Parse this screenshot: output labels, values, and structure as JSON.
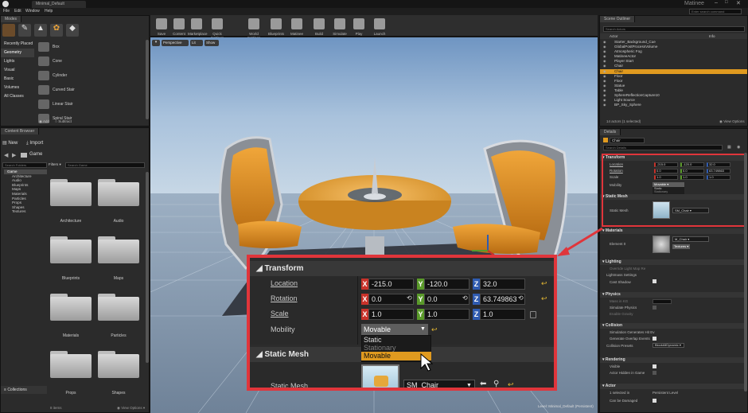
{
  "app": {
    "project_tab": "Minimal_Default",
    "window_title": "Matinee",
    "search_help_placeholder": "Enter search command"
  },
  "menu": [
    "File",
    "Edit",
    "Window",
    "Help"
  ],
  "modes": {
    "tab": "Modes",
    "categories": [
      "Recently Placed",
      "Geometry",
      "Lights",
      "Visual",
      "Basic",
      "Volumes",
      "All Classes"
    ],
    "selected_category": "Geometry",
    "items": [
      "Box",
      "Cone",
      "Cylinder",
      "Curved Stair",
      "Linear Stair",
      "Spiral Stair"
    ],
    "add_label": "Add",
    "subtract_label": "Subtract"
  },
  "toolbar": [
    {
      "label": "Save",
      "icon": "save-icon"
    },
    {
      "label": "Content",
      "icon": "content-icon"
    },
    {
      "label": "Marketplace",
      "icon": "marketplace-icon"
    },
    {
      "label": "Quick Settings",
      "icon": "settings-icon"
    },
    {
      "label": "World Settings",
      "icon": "world-icon"
    },
    {
      "label": "Blueprints",
      "icon": "blueprint-icon"
    },
    {
      "label": "Matinee",
      "icon": "matinee-icon"
    },
    {
      "label": "Build",
      "icon": "build-icon"
    },
    {
      "label": "Simulate",
      "icon": "simulate-icon"
    },
    {
      "label": "Play",
      "icon": "play-icon"
    },
    {
      "label": "Launch",
      "icon": "launch-icon"
    }
  ],
  "viewport": {
    "perspective": "Perspective",
    "lit": "Lit",
    "show": "Show",
    "level_label": "Level:",
    "level_name": "Minimal_Default (Persistent)"
  },
  "content_browser": {
    "tab": "Content Browser",
    "new_label": "New",
    "import_label": "Import",
    "path": "Game",
    "search_folders_placeholder": "Search Folders",
    "filters_label": "Filters",
    "search_game_placeholder": "Search Game",
    "tree": [
      "Game",
      "Architecture",
      "Audio",
      "Blueprints",
      "Maps",
      "Materials",
      "Particles",
      "Props",
      "Shapes",
      "Textures"
    ],
    "folders": [
      "Architecture",
      "Audio",
      "Blueprints",
      "Maps",
      "Materials",
      "Particles",
      "Props",
      "Shapes"
    ],
    "collections_label": "Collections",
    "item_count": "8 items",
    "view_options": "View Options"
  },
  "outliner": {
    "tab": "Scene Outliner",
    "search_placeholder": "Search Actors",
    "col_actor": "Actor",
    "col_info": "Info",
    "rows": [
      "Starter_Background_Cue",
      "GlobalPostProcessVolume",
      "Atmospheric Fog",
      "MatineeActor",
      "Player Start",
      "Chair",
      "Chair",
      "Floor",
      "Floor",
      "Statue",
      "Table",
      "SphereReflectionCapture10",
      "Light Source",
      "BP_Sky_Sphere"
    ],
    "selected_index": 6,
    "status": "14 actors (1 selected)",
    "view_options": "View Options"
  },
  "details": {
    "tab": "Details",
    "name": "Chair",
    "search_placeholder": "Search Details",
    "transform": {
      "section": "Transform",
      "location_label": "Location",
      "rotation_label": "Rotation",
      "scale_label": "Scale",
      "mobility_label": "Mobility",
      "location": [
        "-215.0",
        "-120.0",
        "32.0"
      ],
      "rotation": [
        "0.0",
        "0.0",
        "63.749863"
      ],
      "scale": [
        "1.0",
        "1.0",
        "1.0"
      ],
      "mobility_value": "Movable",
      "mobility_options": [
        "Static",
        "Stationary",
        "Movable"
      ]
    },
    "static_mesh": {
      "section": "Static Mesh",
      "label": "Static Mesh",
      "value": "SM_Chair"
    },
    "materials": {
      "section": "Materials",
      "element_label": "Element 0",
      "value": "M_Chair",
      "textures": "Textures"
    },
    "lighting": {
      "section": "Lighting",
      "rows": [
        "Override Light Map Re",
        "Lightmass Settings",
        "Cast Shadow"
      ]
    },
    "physics": {
      "section": "Physics",
      "rows": [
        "Mass in KG",
        "Simulate Physics",
        "Enable Gravity"
      ]
    },
    "collision": {
      "section": "Collision",
      "rows": [
        "Simulation Generates Hit Ev",
        "Generate Overlap Events",
        "Collision Presets"
      ],
      "preset_value": "BlockAllDynamic"
    },
    "rendering": {
      "section": "Rendering",
      "rows": [
        "Visible",
        "Actor Hidden in Game"
      ]
    },
    "actor": {
      "section": "Actor",
      "selected_label": "1 selected in",
      "selected_value": "Persistent Level",
      "damage_label": "Can be Damaged"
    }
  },
  "colors": {
    "highlight_red": "#e0353b",
    "selection_orange": "#e09a1f",
    "x_axis": "#c8322a",
    "y_axis": "#5a9a2a",
    "z_axis": "#2f5bb0"
  }
}
